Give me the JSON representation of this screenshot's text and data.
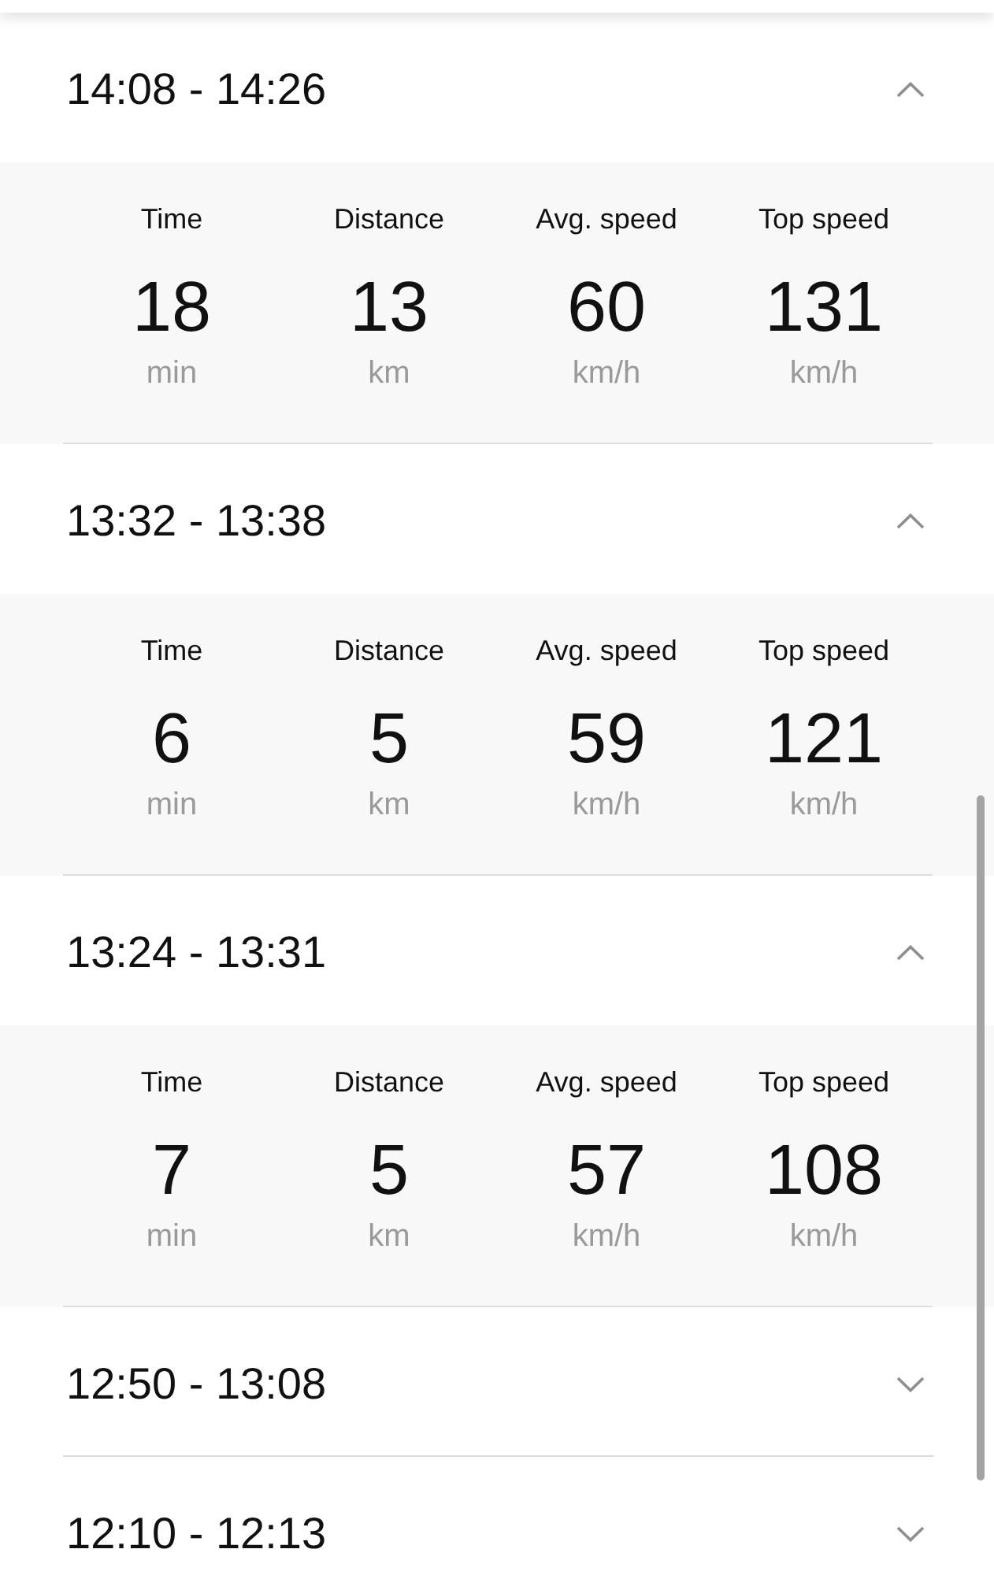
{
  "trips": [
    {
      "title": "14:08 - 14:26",
      "expanded": true,
      "stats": [
        {
          "label": "Time",
          "value": "18",
          "unit": "min"
        },
        {
          "label": "Distance",
          "value": "13",
          "unit": "km"
        },
        {
          "label": "Avg. speed",
          "value": "60",
          "unit": "km/h"
        },
        {
          "label": "Top speed",
          "value": "131",
          "unit": "km/h"
        }
      ]
    },
    {
      "title": "13:32 - 13:38",
      "expanded": true,
      "stats": [
        {
          "label": "Time",
          "value": "6",
          "unit": "min"
        },
        {
          "label": "Distance",
          "value": "5",
          "unit": "km"
        },
        {
          "label": "Avg. speed",
          "value": "59",
          "unit": "km/h"
        },
        {
          "label": "Top speed",
          "value": "121",
          "unit": "km/h"
        }
      ]
    },
    {
      "title": "13:24 - 13:31",
      "expanded": true,
      "stats": [
        {
          "label": "Time",
          "value": "7",
          "unit": "min"
        },
        {
          "label": "Distance",
          "value": "5",
          "unit": "km"
        },
        {
          "label": "Avg. speed",
          "value": "57",
          "unit": "km/h"
        },
        {
          "label": "Top speed",
          "value": "108",
          "unit": "km/h"
        }
      ]
    },
    {
      "title": "12:50 - 13:08",
      "expanded": false
    },
    {
      "title": "12:10 - 12:13",
      "expanded": false
    }
  ]
}
